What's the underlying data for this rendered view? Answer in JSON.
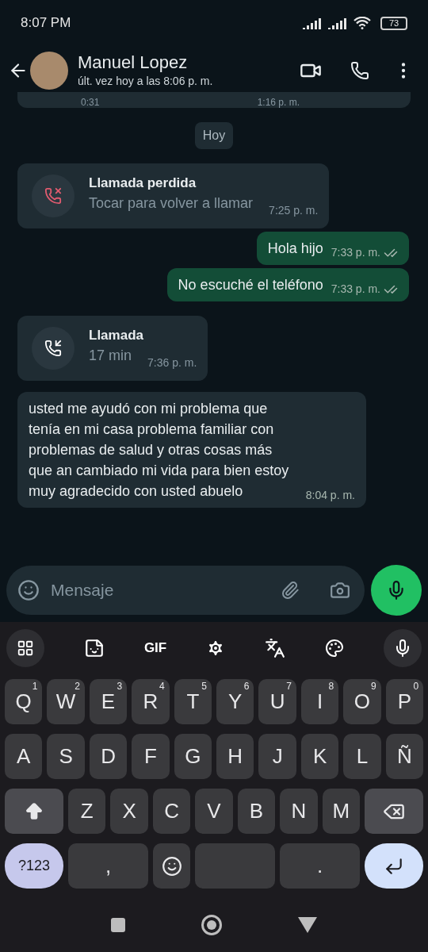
{
  "status_bar": {
    "time": "8:07 PM",
    "battery": "73"
  },
  "header": {
    "name": "Manuel Lopez",
    "last_seen": "últ. vez hoy a las 8:06 p. m."
  },
  "messages": [
    {
      "kind": "cut",
      "left": "0:31",
      "time": "1:16 p. m."
    },
    {
      "kind": "date",
      "text": "Hoy"
    },
    {
      "kind": "call",
      "missed": true,
      "title": "Llamada perdida",
      "detail": "Tocar para volver a llamar",
      "time": "7:25 p. m."
    },
    {
      "kind": "text",
      "outgoing": true,
      "text": "Hola hijo",
      "time": "7:33 p. m."
    },
    {
      "kind": "text",
      "outgoing": true,
      "text": "No escuché el teléfono",
      "time": "7:33 p. m."
    },
    {
      "kind": "call",
      "missed": false,
      "title": "Llamada",
      "detail": "17 min",
      "time": "7:36 p. m."
    },
    {
      "kind": "text",
      "outgoing": false,
      "text": "usted me ayudó con mi problema que tenía en mi casa problema familiar con problemas de salud y otras cosas más que an cambiado mi vida para bien estoy muy agradecido con usted abuelo",
      "time": "8:04 p. m."
    }
  ],
  "composer": {
    "placeholder": "Mensaje"
  },
  "keyboard": {
    "toolbar_label": "GIF",
    "rows": [
      {
        "keys": [
          {
            "kind": "letter",
            "label": "Q",
            "hint": "1"
          },
          {
            "kind": "letter",
            "label": "W",
            "hint": "2"
          },
          {
            "kind": "letter",
            "label": "E",
            "hint": "3"
          },
          {
            "kind": "letter",
            "label": "R",
            "hint": "4"
          },
          {
            "kind": "letter",
            "label": "T",
            "hint": "5"
          },
          {
            "kind": "letter",
            "label": "Y",
            "hint": "6"
          },
          {
            "kind": "letter",
            "label": "U",
            "hint": "7"
          },
          {
            "kind": "letter",
            "label": "I",
            "hint": "8"
          },
          {
            "kind": "letter",
            "label": "O",
            "hint": "9"
          },
          {
            "kind": "letter",
            "label": "P",
            "hint": "0"
          }
        ]
      },
      {
        "keys": [
          {
            "kind": "letter",
            "label": "A"
          },
          {
            "kind": "letter",
            "label": "S"
          },
          {
            "kind": "letter",
            "label": "D"
          },
          {
            "kind": "letter",
            "label": "F"
          },
          {
            "kind": "letter",
            "label": "G"
          },
          {
            "kind": "letter",
            "label": "H"
          },
          {
            "kind": "letter",
            "label": "J"
          },
          {
            "kind": "letter",
            "label": "K"
          },
          {
            "kind": "letter",
            "label": "L"
          },
          {
            "kind": "letter",
            "label": "Ñ"
          }
        ]
      },
      {
        "keys": [
          {
            "kind": "shift"
          },
          {
            "kind": "letter",
            "label": "Z"
          },
          {
            "kind": "letter",
            "label": "X"
          },
          {
            "kind": "letter",
            "label": "C"
          },
          {
            "kind": "letter",
            "label": "V"
          },
          {
            "kind": "letter",
            "label": "B"
          },
          {
            "kind": "letter",
            "label": "N"
          },
          {
            "kind": "letter",
            "label": "M"
          },
          {
            "kind": "backspace"
          }
        ]
      },
      {
        "keys": [
          {
            "kind": "symbols",
            "label": "?123"
          },
          {
            "kind": "letter",
            "label": ","
          },
          {
            "kind": "emoji"
          },
          {
            "kind": "space"
          },
          {
            "kind": "letter",
            "label": "."
          },
          {
            "kind": "enter"
          }
        ]
      }
    ]
  }
}
